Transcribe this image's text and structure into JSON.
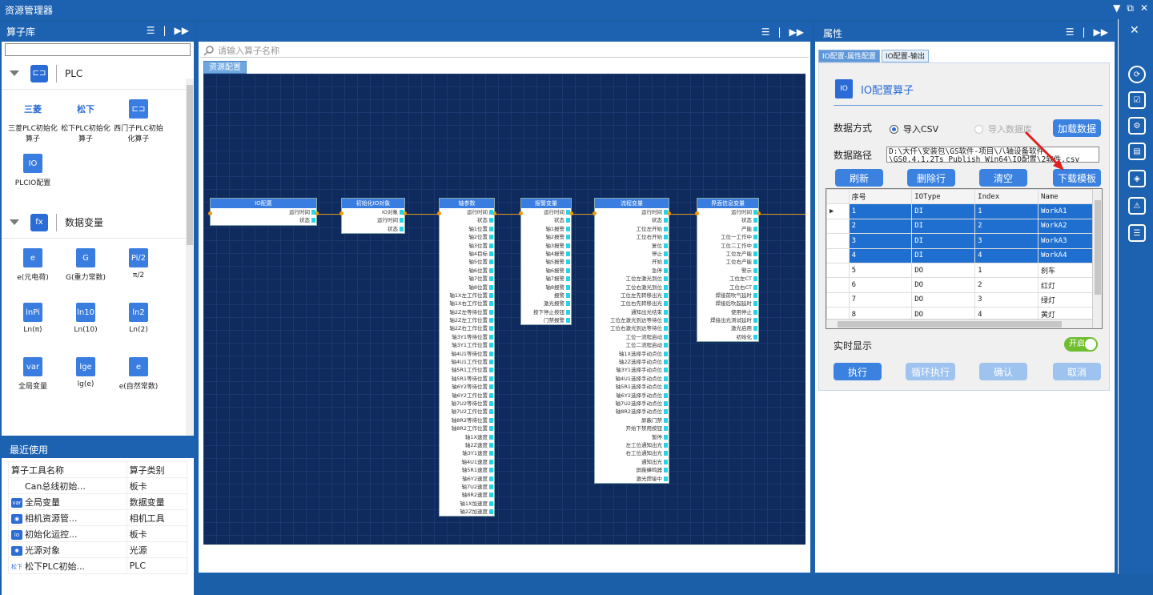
{
  "window": {
    "title": "资源管理器",
    "controls": [
      "▼",
      "⧉",
      "✕"
    ]
  },
  "left": {
    "title": "算子库",
    "categories": [
      {
        "name": "PLC",
        "icon": "plc-icon",
        "tiles": [
          {
            "label": "三菱PLC初始化算子",
            "icon": "三菱"
          },
          {
            "label": "松下PLC初始化算子",
            "icon": "松下"
          },
          {
            "label": "西门子PLC初始化算子",
            "icon": "西门子"
          },
          {
            "label": "PLCIO配置",
            "icon": "IO"
          }
        ]
      },
      {
        "name": "数据变量",
        "icon": "fx",
        "tiles": [
          {
            "label": "e(元电荷)",
            "icon": "e"
          },
          {
            "label": "G(重力常数)",
            "icon": "G"
          },
          {
            "label": "π/2",
            "icon": "Pi/2"
          },
          {
            "label": "Ln(π)",
            "icon": "lnPi"
          },
          {
            "label": "Ln(10)",
            "icon": "ln10"
          },
          {
            "label": "Ln(2)",
            "icon": "ln2"
          },
          {
            "label": "全局变量",
            "icon": "var"
          },
          {
            "label": "lg(e)",
            "icon": "lge"
          },
          {
            "label": "e(自然常数)",
            "icon": "e"
          }
        ]
      }
    ],
    "recent": {
      "title": "最近使用",
      "headers": [
        "算子工具名称",
        "算子类别"
      ],
      "rows": [
        {
          "icon": "",
          "name": "Can总线初始...",
          "cat": "板卡"
        },
        {
          "icon": "var",
          "name": "全局变量",
          "cat": "数据变量"
        },
        {
          "icon": "cam",
          "name": "相机资源管...",
          "cat": "相机工具"
        },
        {
          "icon": "io",
          "name": "初始化运控...",
          "cat": "板卡"
        },
        {
          "icon": "lt",
          "name": "光源对象",
          "cat": "光源"
        },
        {
          "icon": "松下",
          "name": "松下PLC初始...",
          "cat": "PLC"
        }
      ]
    }
  },
  "center": {
    "search_placeholder": "请输入算子名称",
    "tab": "资源配置",
    "nodes": [
      {
        "title": "IO配置",
        "ports": [
          "运行时间",
          "状态"
        ]
      },
      {
        "title": "初始化IO对象",
        "ports": [
          "IO对象",
          "运行时间",
          "状态"
        ]
      },
      {
        "title": "轴参数",
        "ports": [
          "运行时间",
          "状态",
          "轴1位置",
          "轴2位置",
          "轴3位置",
          "轴4目标",
          "轴5位置",
          "轴6位置",
          "轴7位置",
          "轴8位置",
          "轴1X左工作位置",
          "轴1X右工作位置",
          "轴2Z左等待位置",
          "轴2Z左工作位置",
          "轴2Z右工作位置",
          "轴3Y1等待位置",
          "轴3Y1工作位置",
          "轴4U1等待位置",
          "轴4U1工作位置",
          "轴5R1工作位置",
          "轴5R1等待位置",
          "轴6Y2等待位置",
          "轴6Y2工作位置",
          "轴7U2等待位置",
          "轴7U2工作位置",
          "轴8R2等待位置",
          "轴8R2工作位置",
          "轴1X速度",
          "轴2Z速度",
          "轴3Y1速度",
          "轴4U1速度",
          "轴5R1速度",
          "轴6Y2速度",
          "轴7U2速度",
          "轴8R2速度",
          "轴1X加速度",
          "轴2Z加速度"
        ]
      },
      {
        "title": "报警变量",
        "ports": [
          "运行时间",
          "状态",
          "轴1报警",
          "轴2报警",
          "轴3报警",
          "轴4报警",
          "轴5报警",
          "轴6报警",
          "轴7报警",
          "轴8报警",
          "报警",
          "激光报警",
          "按下停止按钮",
          "门禁报警"
        ]
      },
      {
        "title": "流程变量",
        "ports": [
          "运行时间",
          "状态",
          "工位左开始",
          "工位右开始",
          "复位",
          "停止",
          "开始",
          "急停",
          "工位左激光到位",
          "工位右激光到位",
          "工位左先转移出光",
          "工位右先转移出光",
          "通知出光结束",
          "工位左激光到达等待位",
          "工位右激光到达等待位",
          "工位一流程启动",
          "工位二流程启动",
          "轴1X选择手动点位",
          "轴2Z选择手动点位",
          "轴3Y1选择手动点位",
          "轴4U1选择手动点位",
          "轴5R1选择手动点位",
          "轴6Y2选择手动点位",
          "轴7U2选择手动点位",
          "轴8R2选择手动点位",
          "屏蔽门禁",
          "开始下禁用按钮",
          "暂停",
          "左工位通知出光",
          "右工位通知出光",
          "通知出光",
          "屏蔽蜂鸣器",
          "激光焊接中"
        ]
      },
      {
        "title": "界面信息变量",
        "ports": [
          "运行时间",
          "状态",
          "产能",
          "工位一工作中",
          "工位二工作中",
          "工位左产能",
          "工位右产能",
          "警示",
          "工位左CT",
          "工位右CT",
          "焊接前吹气延时",
          "焊接后吹起延时",
          "使用停止",
          "焊接出光测试延时",
          "激光启用",
          "初始化"
        ]
      }
    ]
  },
  "right": {
    "title": "属性",
    "tabs": [
      "IO配置-属性配置",
      "IO配置-输出"
    ],
    "heading": "IO配置算子",
    "data_mode_label": "数据方式",
    "radio_csv": "导入CSV",
    "radio_db": "导入数据库",
    "load_button": "加载数据",
    "path_label": "数据路径",
    "path_line1": "D:\\大仟\\安装包\\GS软件-项目\\八轴设备软件",
    "path_line2": "\\GS0.4.1.2Ts_Publish_Win64\\IO配置\\2软件.csv",
    "btn_refresh": "刷新",
    "btn_delete": "删除行",
    "btn_clear": "清空",
    "btn_template": "下载模板",
    "table_headers": [
      "序号",
      "IOType",
      "Index",
      "Name"
    ],
    "table_rows": [
      [
        "1",
        "DI",
        "1",
        "WorkA1"
      ],
      [
        "2",
        "DI",
        "2",
        "WorkA2"
      ],
      [
        "3",
        "DI",
        "3",
        "WorkA3"
      ],
      [
        "4",
        "DI",
        "4",
        "WorkA4"
      ],
      [
        "5",
        "DO",
        "1",
        "刹车"
      ],
      [
        "6",
        "DO",
        "2",
        "红灯"
      ],
      [
        "7",
        "DO",
        "3",
        "绿灯"
      ],
      [
        "8",
        "DO",
        "4",
        "黄灯"
      ]
    ],
    "realtime_label": "实时显示",
    "toggle_text": "开启",
    "btn_run": "执行",
    "btn_loop": "循环执行",
    "btn_confirm": "确认",
    "btn_cancel": "取消"
  },
  "colors": {
    "chrome": "#1d62b0",
    "canvas": "#0f2a5c",
    "button": "#3b82e0",
    "toggle": "#6fbe2f"
  }
}
